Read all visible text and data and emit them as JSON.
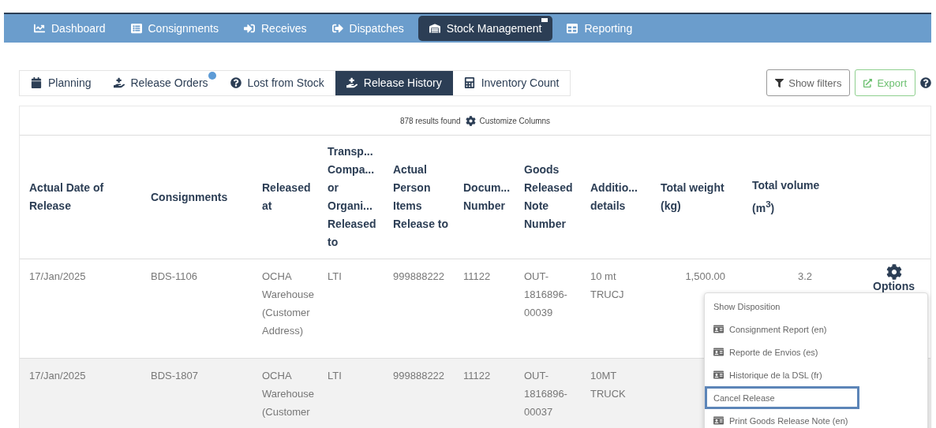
{
  "nav": [
    {
      "label": "Dashboard",
      "selected": false
    },
    {
      "label": "Consignments",
      "selected": false
    },
    {
      "label": "Receives",
      "selected": false
    },
    {
      "label": "Dispatches",
      "selected": false
    },
    {
      "label": "Stock Management",
      "selected": true,
      "badge": true
    },
    {
      "label": "Reporting",
      "selected": false
    }
  ],
  "tabs": [
    {
      "label": "Planning",
      "selected": false
    },
    {
      "label": "Release Orders",
      "selected": false,
      "badge": true
    },
    {
      "label": "Lost from Stock",
      "selected": false
    },
    {
      "label": "Release History",
      "selected": true
    },
    {
      "label": "Inventory Count",
      "selected": false
    }
  ],
  "toolbar": {
    "filters_button": "Show filters",
    "export_button": "Export"
  },
  "results": {
    "count": "878 results found",
    "customize": "Customize Columns"
  },
  "table": {
    "columns": [
      "Actual Date of Release",
      "Consignments",
      "Released at",
      "Transp... Compa... or Organi... Released to",
      "Actual Person Items Release to",
      "Docum... Number",
      "Goods Released Note Number",
      "Additio... details",
      "Total weight (kg)",
      "Total volume (m$^{3}$)"
    ],
    "rows": [
      {
        "cells": [
          "17/Jan/2025",
          "BDS-1106",
          "OCHA Warehouse (Customer Address)",
          "LTI",
          "999888222",
          "11122",
          "OUT-1816896-00039",
          "10 mt TRUCJ",
          "1,500.00",
          "3.2"
        ],
        "options": "Options"
      },
      {
        "cells": [
          "17/Jan/2025",
          "BDS-1807",
          "OCHA Warehouse (Customer",
          "LTI",
          "999888222",
          "11122",
          "OUT-1816896-00037",
          "10MT TRUCK"
        ]
      }
    ]
  },
  "menu": [
    {
      "label": "Show Disposition",
      "kind": "plain",
      "selected": false
    },
    {
      "label": "Consignment Report (en)",
      "kind": "report",
      "selected": false
    },
    {
      "label": "Reporte de Envios (es)",
      "kind": "report",
      "selected": false
    },
    {
      "label": "Historique de la DSL (fr)",
      "kind": "report",
      "selected": false
    },
    {
      "label": "Cancel Release",
      "kind": "plain",
      "selected": true
    },
    {
      "label": "Print Goods Release Note (en)",
      "kind": "report",
      "selected": false
    }
  ]
}
